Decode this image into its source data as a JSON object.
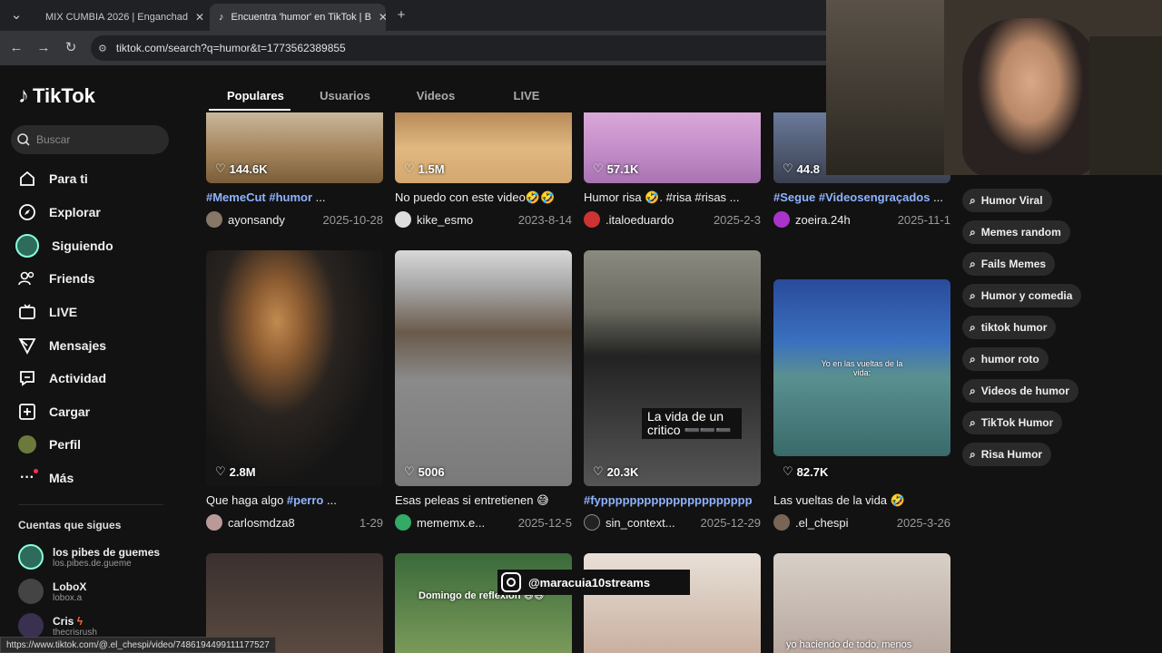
{
  "browser": {
    "tabs": [
      {
        "title": "MIX CUMBIA 2026 | Enganchad",
        "icon": "youtube-icon",
        "active": false
      },
      {
        "title": "Encuentra 'humor' en TikTok | B",
        "icon": "tiktok-icon",
        "active": true
      }
    ],
    "url": "tiktok.com/search?q=humor&t=1773562389855",
    "status_url": "https://www.tiktok.com/@.el_chespi/video/7486194499111177527"
  },
  "app": {
    "logo": "TikTok",
    "search_placeholder": "Buscar",
    "nav": [
      {
        "label": "Para ti",
        "icon": "home-icon"
      },
      {
        "label": "Explorar",
        "icon": "compass-icon"
      },
      {
        "label": "Siguiendo",
        "icon": "following-avatar-icon"
      },
      {
        "label": "Friends",
        "icon": "friends-icon"
      },
      {
        "label": "LIVE",
        "icon": "live-icon"
      },
      {
        "label": "Mensajes",
        "icon": "send-icon"
      },
      {
        "label": "Actividad",
        "icon": "activity-icon"
      },
      {
        "label": "Cargar",
        "icon": "upload-icon"
      },
      {
        "label": "Perfil",
        "icon": "profile-avatar-icon"
      },
      {
        "label": "Más",
        "icon": "more-icon"
      }
    ],
    "following_title": "Cuentas que sigues",
    "following": [
      {
        "name": "los pibes de guemes",
        "handle": "los.pibes.de.gueme"
      },
      {
        "name": "LoboX",
        "handle": "lobox.a"
      },
      {
        "name": "Cris",
        "handle": "thecrisrush"
      }
    ],
    "tabs": [
      "Populares",
      "Usuarios",
      "Videos",
      "LIVE"
    ],
    "row1": [
      {
        "likes": "144.6K",
        "title_tag": "#MemeCut #humor",
        "title_text": " ...",
        "user": "ayonsandy",
        "date": "2025-10-28"
      },
      {
        "likes": "1.5M",
        "title_tag": "",
        "title_text": "No puedo con este video🤣🤣",
        "user": "kike_esmo",
        "date": "2023-8-14"
      },
      {
        "likes": "57.1K",
        "title_tag": "",
        "title_text": "Humor risa 🤣. #risa #risas ...",
        "user": ".italoeduardo",
        "date": "2025-2-3"
      },
      {
        "likes": "44.8",
        "title_tag": "#Segue #Videosengraçados",
        "title_text": " ...",
        "user": "zoeira.24h",
        "date": "2025-11-1"
      }
    ],
    "row2": [
      {
        "likes": "2.8M",
        "title_tag": "#perro",
        "title_text": "Que haga algo ",
        "title_suffix": " ...",
        "user": "carlosmdza8",
        "date": "1-29"
      },
      {
        "likes": "5006",
        "title_tag": "",
        "title_text": "Esas peleas si entretienen 😅",
        "title_suffix": "",
        "user": "mememx.e...",
        "date": "2025-12-5"
      },
      {
        "likes": "20.3K",
        "title_tag": "#fyppppppppppppppppppppp",
        "title_text": "",
        "title_suffix": "",
        "user": "sin_context...",
        "date": "2025-12-29"
      },
      {
        "likes": "82.7K",
        "title_tag": "",
        "title_text": "Las vueltas de la vida 🤣",
        "title_suffix": "",
        "user": ".el_chespi",
        "date": "2025-3-26"
      }
    ],
    "overlay_captions": {
      "critico": "La vida de un critico ➖➖➖",
      "vueltas": "Yo en las vueltas de la vida:",
      "domingo": "Domingo de reflexión 😅😅",
      "haciendo": "yo haciendo de todo, menos"
    },
    "suggestions": [
      "Humor Viral",
      "Memes random",
      "Fails Memes",
      "Humor y comedia",
      "tiktok humor",
      "humor roto",
      "Videos de humor",
      "TikTok Humor",
      "Risa Humor"
    ],
    "instagram_handle": "@maracuia10streams"
  }
}
